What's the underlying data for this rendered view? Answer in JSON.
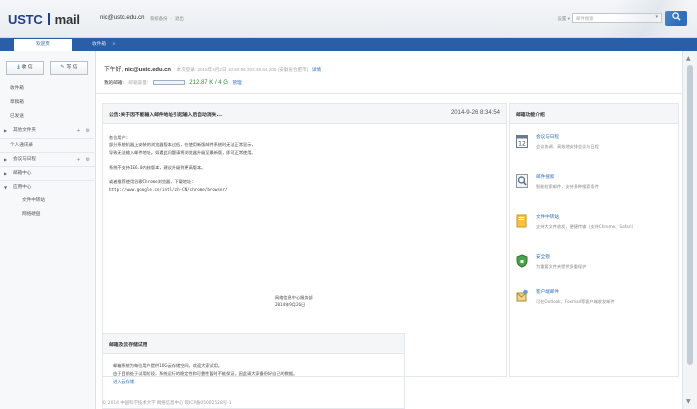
{
  "header": {
    "logo_ustc": "USTC",
    "logo_mail": "mail",
    "user_email": "nic@ustc.edu.cn",
    "links": [
      "系统备份",
      "·",
      "退出"
    ],
    "right_links": [
      "设置 ▾",
      "|",
      "自动加载 ·",
      "|",
      "退出"
    ],
    "search_placeholder": "邮件搜索"
  },
  "tabs": {
    "active": "欢迎页",
    "inactive": "收件箱"
  },
  "sidebar": {
    "receive_label": "收 信",
    "write_label": "写 信",
    "items": [
      {
        "label": "收件箱"
      },
      {
        "label": "草稿箱"
      },
      {
        "label": "已发送"
      },
      {
        "label": "其他文件夹",
        "ops": [
          "+",
          "⚙"
        ]
      },
      {
        "label": "个人通讯录"
      },
      {
        "label": "会议与日程",
        "ops": [
          "+",
          "⚙"
        ]
      },
      {
        "label": "邮箱中心"
      },
      {
        "label": "应用中心"
      },
      {
        "label": "文件中转站"
      },
      {
        "label": "网络硬盘"
      }
    ]
  },
  "main": {
    "greeting": "下午好,",
    "greeting_name": "nic@ustc.edu.cn",
    "last_login": "本次登录: 2015年4月2日 10:50:56 202.38.64.208 (安徽省合肥市)",
    "detail": "详情",
    "mailbox_label": "我的邮箱:",
    "capacity_label": "邮箱容量:",
    "capacity_value": "212.87 K / 4 G",
    "manage": "管理"
  },
  "notice": {
    "title": "公告:关于因不能输入邮件地址引起输入后自动消失...",
    "time": "2014-9-26 8:34:54",
    "lines": [
      "各位用户:",
      "    部分系统机器上安装的浏览器版本过低，在使用新版邮件系统时无法正常显示，",
      "导致无法输入邮件地址。如遇此问题请将浏览器升级至最新版，即可正常使用。",
      "",
      "系统不支持IE6.0内核版本，建议升级到更高版本。",
      "",
      "或者推荐使用谷歌Chrome浏览器，下载地址:",
      "http://www.google.cn/intl/zh-CN/chrome/browser/"
    ],
    "sign_1": "网络信息中心服务部",
    "sign_2": "2014年9月26日"
  },
  "info": {
    "title": "邮箱功能介绍",
    "features": [
      {
        "icon": "calendar-icon",
        "name": "会议与日程",
        "desc": "会议协调、高效地安排会议与日程"
      },
      {
        "icon": "magnifier-icon",
        "name": "邮件搜索",
        "desc": "智能检索邮件，支持多种搜索条件"
      },
      {
        "icon": "folder-icon",
        "name": "文件中转站",
        "desc": "支持大文件收发，便捷传输（支持Chrome、Safari）"
      },
      {
        "icon": "shield-icon",
        "name": "安全锁",
        "desc": "为重要文件夹提供多重保护"
      },
      {
        "icon": "client-icon",
        "name": "客户端邮件",
        "desc": "可在Outlook、Foxmail等客户端收发邮件"
      }
    ]
  },
  "storage": {
    "title": "邮箱及云存储试用",
    "line_1": "邮箱系统为每位用户提供10G云存储空间，欢迎大家试用。",
    "line_2": "由于目前处于试用阶段，系统运行的稳定性和可靠性暂时不能保证，因此请大家备份好自己的数据。",
    "link": "进入云存储"
  },
  "footer": "© 2014 中国科学技术大学 网络信息中心 皖ICP备05002528号-1",
  "colors": {
    "tab_bar": "#2a5fa7",
    "link": "#2c6fbd",
    "capacity": "#2c8a3a"
  }
}
